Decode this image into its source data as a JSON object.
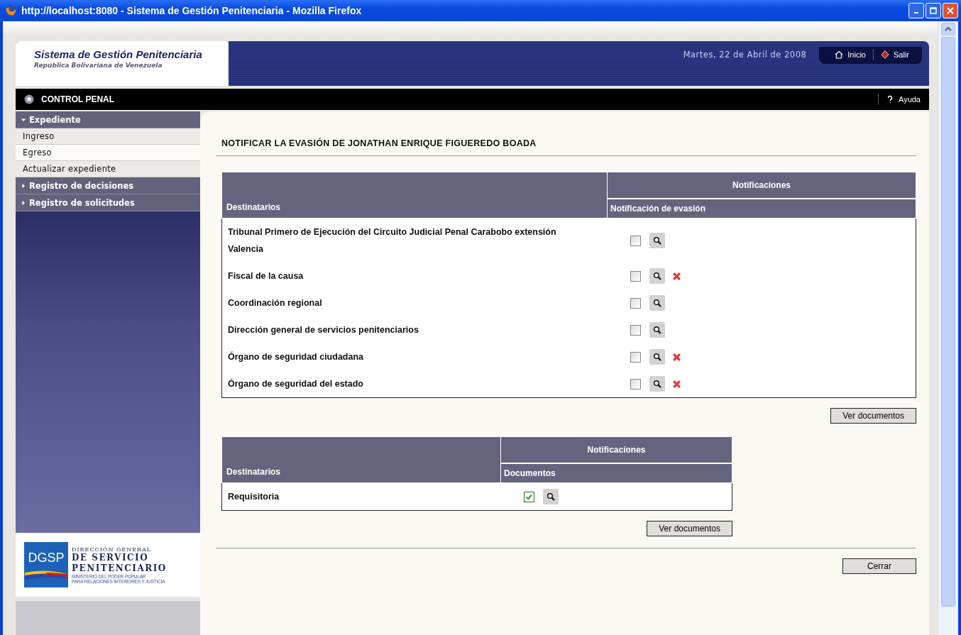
{
  "window": {
    "title": "http://localhost:8080 - Sistema de Gestión Penitenciaria - Mozilla Firefox"
  },
  "header": {
    "title": "Sistema de Gestión Penitenciaria",
    "subtitle": "República Bolivariana de Venezuela",
    "date": "Martes, 22 de Abril de 2008",
    "links": [
      {
        "label": "Inicio",
        "kind": "home"
      },
      {
        "label": "Salir",
        "kind": "exit"
      }
    ]
  },
  "module_bar": {
    "title": "CONTROL PENAL",
    "help": "Ayuda"
  },
  "sidebar": {
    "items": [
      {
        "kind": "section",
        "label": "Expediente",
        "expanded": true,
        "children": [
          {
            "label": "Ingreso",
            "selected": false
          },
          {
            "label": "Egreso",
            "selected": true
          },
          {
            "label": "Actualizar expediente",
            "selected": false
          }
        ]
      },
      {
        "kind": "section",
        "label": "Registro de decisiones",
        "expanded": false
      },
      {
        "kind": "section",
        "label": "Registro de solicitudes",
        "expanded": false
      }
    ],
    "logo": {
      "acronym": "DGSP",
      "line_1": "DIRECCIÓN GENERAL",
      "line_2": "DE SERVICIO",
      "line_3": "PENITENCIARIO",
      "line_4": "MINISTERIO DEL PODER POPULAR",
      "line_5": "PARA RELACIONES INTERIORES Y JUSTICIA"
    }
  },
  "heading": "NOTIFICAR LA EVASIÓN DE JONATHAN ENRIQUE FIGUEREDO BOADA",
  "tables": [
    {
      "col_recipients": "Destinatarios",
      "group": "Notificaciones",
      "subcolumn": "Notificación de evasión",
      "button": "Ver documentos",
      "rows": [
        {
          "name": "Tribunal Primero de Ejecución del Circuito Judicial Penal Carabobo extensión Valencia",
          "checked": false,
          "deletable": false
        },
        {
          "name": "Fiscal de la causa",
          "checked": false,
          "deletable": true
        },
        {
          "name": "Coordinación regional",
          "checked": false,
          "deletable": false
        },
        {
          "name": "Dirección general de servicios penitenciarios",
          "checked": false,
          "deletable": false
        },
        {
          "name": "Órgano de seguridad ciudadana",
          "checked": false,
          "deletable": true
        },
        {
          "name": "Órgano de seguridad del estado",
          "checked": false,
          "deletable": true
        }
      ]
    },
    {
      "col_recipients": "Destinatarios",
      "group": "Notificaciones",
      "subcolumn": "Documentos",
      "button": "Ver documentos",
      "rows": [
        {
          "name": "Requisitoria",
          "checked": true,
          "deletable": false
        }
      ]
    }
  ],
  "close_button": "Cerrar"
}
